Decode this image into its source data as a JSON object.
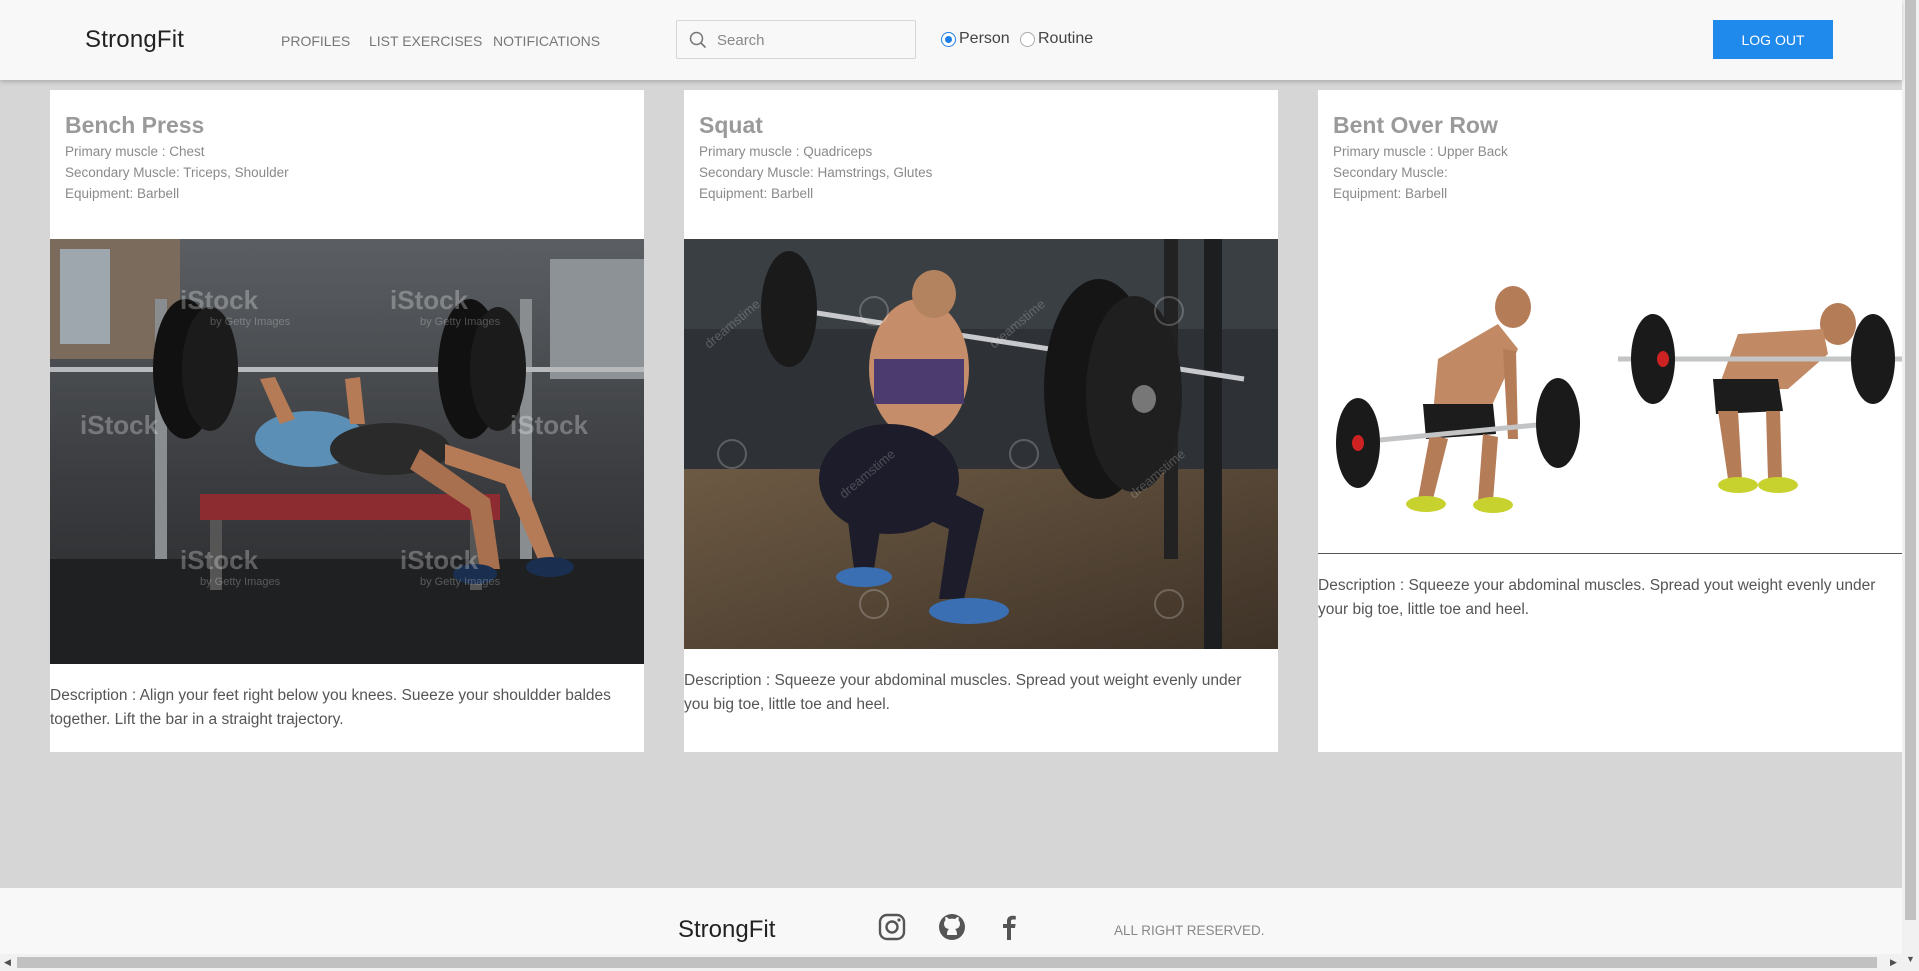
{
  "header": {
    "brand": "StrongFit",
    "nav": [
      "PROFILES",
      "LIST EXERCISES",
      "NOTIFICATIONS"
    ],
    "search": {
      "placeholder": "Search",
      "value": ""
    },
    "radios": [
      {
        "label": "Person",
        "checked": true
      },
      {
        "label": "Routine",
        "checked": false
      }
    ],
    "logout_label": "LOG OUT"
  },
  "cards": [
    {
      "title": "Bench Press",
      "primary": "Primary muscle : Chest",
      "secondary": "Secondary Muscle: Triceps, Shoulder",
      "equipment": "Equipment: Barbell",
      "description": "Description : Align your feet right below you knees. Sueeze your shouldder baldes together. Lift the bar in a straight trajectory.",
      "image_alt": "bench-press-photo",
      "watermark": "iStock",
      "watermark_sub": "by Getty Images"
    },
    {
      "title": "Squat",
      "primary": "Primary muscle : Quadriceps",
      "secondary": "Secondary Muscle: Hamstrings, Glutes",
      "equipment": "Equipment: Barbell",
      "description": "Description : Squeeze your abdominal muscles. Spread yout weight evenly under you big toe, little toe and heel.",
      "image_alt": "squat-photo",
      "watermark": "dreamstime"
    },
    {
      "title": "Bent Over Row",
      "primary": "Primary muscle : Upper Back",
      "secondary": "Secondary Muscle:",
      "equipment": "Equipment: Barbell",
      "description": "Description : Squeeze your abdominal muscles. Spread yout weight evenly under your big toe, little toe and heel.",
      "image_alt": "bent-over-row-photo"
    }
  ],
  "footer": {
    "brand": "StrongFit",
    "icons": [
      "instagram-icon",
      "github-icon",
      "facebook-icon"
    ],
    "rights": "ALL RIGHT RESERVED."
  },
  "colors": {
    "accent": "#2089ec",
    "background": "#d6d6d6",
    "card": "#ffffff",
    "title": "#9a9a9a"
  }
}
